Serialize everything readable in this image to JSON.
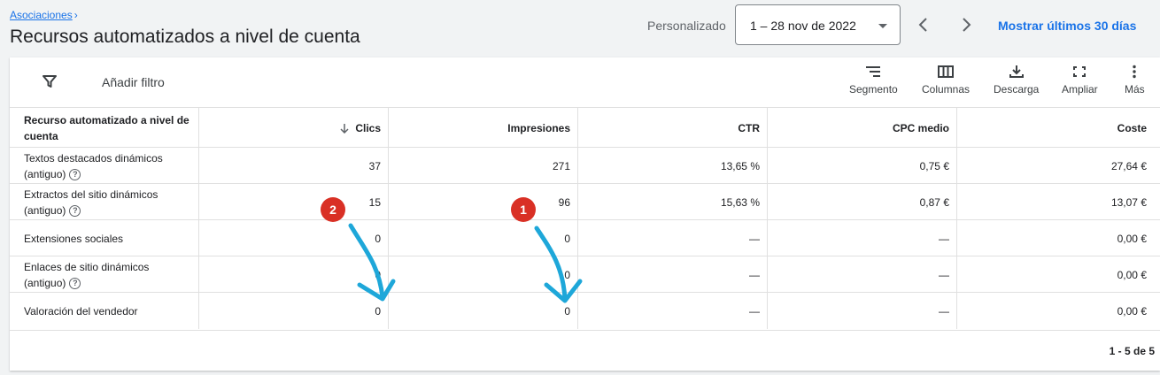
{
  "header": {
    "breadcrumb": "Asociaciones",
    "title": "Recursos automatizados a nivel de cuenta",
    "range_label": "Personalizado",
    "date_range": "1 – 28 nov de 2022",
    "last_30": "Mostrar últimos 30 días"
  },
  "toolbar": {
    "add_filter": "Añadir filtro",
    "segment": "Segmento",
    "columns": "Columnas",
    "download": "Descarga",
    "expand": "Ampliar",
    "more": "Más"
  },
  "table": {
    "columns": [
      "Recurso automatizado a nivel de cuenta",
      "Clics",
      "Impresiones",
      "CTR",
      "CPC medio",
      "Coste"
    ],
    "rows": [
      {
        "name": "Textos destacados dinámicos",
        "name2": "(antiguo)",
        "clicks": "37",
        "impressions": "271",
        "ctr": "13,65 %",
        "cpc": "0,75 €",
        "cost": "27,64 €"
      },
      {
        "name": "Extractos del sitio dinámicos",
        "name2": "(antiguo)",
        "clicks": "15",
        "impressions": "96",
        "ctr": "15,63 %",
        "cpc": "0,87 €",
        "cost": "13,07 €"
      },
      {
        "name": "Extensiones sociales",
        "name2": "",
        "clicks": "0",
        "impressions": "0",
        "ctr": "—",
        "cpc": "—",
        "cost": "0,00 €"
      },
      {
        "name": "Enlaces de sitio dinámicos",
        "name2": "(antiguo)",
        "clicks": "0",
        "impressions": "0",
        "ctr": "—",
        "cpc": "—",
        "cost": "0,00 €"
      },
      {
        "name": "Valoración del vendedor",
        "name2": "",
        "clicks": "0",
        "impressions": "0",
        "ctr": "—",
        "cpc": "—",
        "cost": "0,00 €"
      }
    ],
    "pagination": "1 - 5 de 5"
  },
  "annotations": {
    "badge1": "1",
    "badge2": "2",
    "badge_color": "#d93025",
    "arrow_color": "#1ea7d9"
  },
  "colors": {
    "accent": "#1a73e8"
  }
}
